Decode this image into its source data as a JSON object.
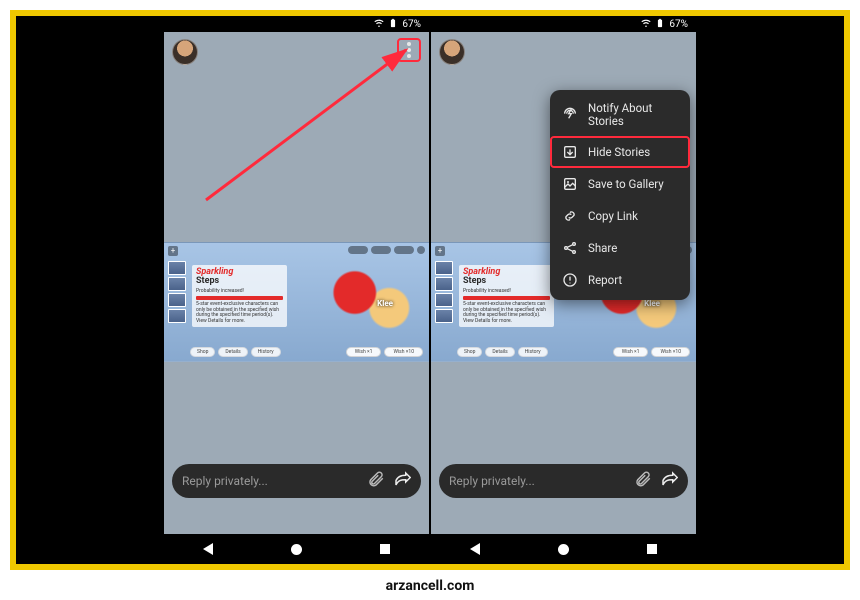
{
  "status": {
    "battery": "67%"
  },
  "reply": {
    "placeholder": "Reply privately..."
  },
  "menu": {
    "notify": "Notify About Stories",
    "hide": "Hide Stories",
    "save": "Save to Gallery",
    "copy": "Copy Link",
    "share": "Share",
    "report": "Report"
  },
  "story": {
    "title1": "Sparkling",
    "title2": "Steps",
    "sub": "Probability increased!",
    "character": "Klee",
    "btn_shop": "Shop",
    "btn_details": "Details",
    "btn_history": "History",
    "btn_wish1": "Wish ×1",
    "btn_wish10": "Wish ×10"
  },
  "watermark": "arzancell.com"
}
